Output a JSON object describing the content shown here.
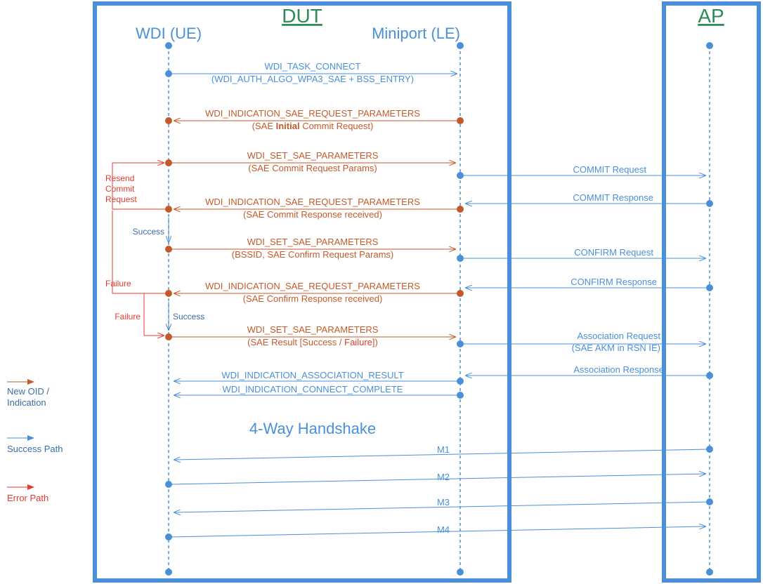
{
  "titles": {
    "dut": "DUT",
    "ap": "AP"
  },
  "lanes": {
    "wdi": "WDI (UE)",
    "miniport": "Miniport (LE)"
  },
  "handshakeTitle": "4-Way Handshake",
  "legend": {
    "new": "New OID /",
    "new2": "Indication",
    "success": "Success Path",
    "error": "Error Path"
  },
  "resend": {
    "l1": "Resend",
    "l2": "Commit",
    "l3": "Request"
  },
  "failure": "Failure",
  "success": "Success",
  "msgs": {
    "connect1": "WDI_TASK_CONNECT",
    "connect2": "(WDI_AUTH_ALGO_WPA3_SAE + BSS_ENTRY)",
    "ind1": "WDI_INDICATION_SAE_REQUEST_PARAMETERS",
    "ind1b": "(SAE ",
    "ind1bBold": "Initial",
    "ind1bEnd": " Commit Request)",
    "set1": "WDI_SET_SAE_PARAMETERS",
    "set1b": "(SAE Commit Request Params)",
    "ind2": "WDI_INDICATION_SAE_REQUEST_PARAMETERS",
    "ind2b": "(SAE Commit Response received)",
    "set2": "WDI_SET_SAE_PARAMETERS",
    "set2b": "(BSSID, SAE Confirm Request Params)",
    "ind3": "WDI_INDICATION_SAE_REQUEST_PARAMETERS",
    "ind3b": "(SAE Confirm Response received)",
    "set3": "WDI_SET_SAE_PARAMETERS",
    "set3bA": "(SAE Result [Success / ",
    "set3bFail": "Failure",
    "set3bB": "])",
    "assocRes": "WDI_INDICATION_ASSOCIATION_RESULT",
    "connComp": "WDI_INDICATION_CONNECT_COMPLETE"
  },
  "apside": {
    "commitReq": "COMMIT Request",
    "commitResp": "COMMIT Response",
    "confirmReq": "CONFIRM Request",
    "confirmResp": "CONFIRM Response",
    "assocReq": "Association Request",
    "assocReq2": "(SAE AKM in RSN IE)",
    "assocResp": "Association Response"
  },
  "hs": {
    "m1": "M1",
    "m2": "M2",
    "m3": "M3",
    "m4": "M4"
  }
}
